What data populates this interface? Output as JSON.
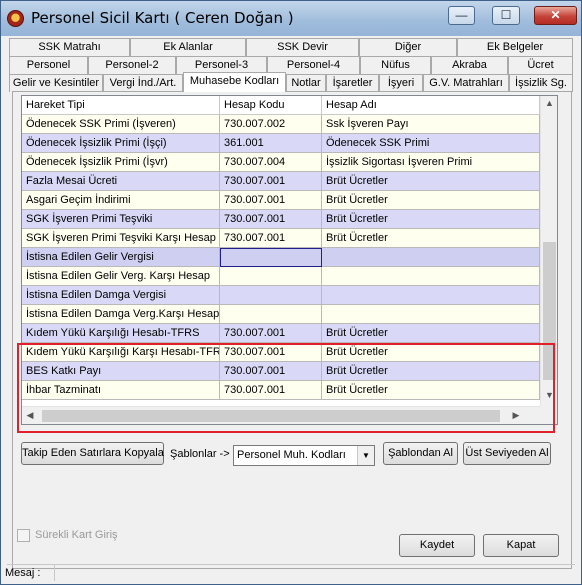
{
  "window": {
    "title": "Personel Sicil Kartı ( Ceren Doğan )",
    "controls": {
      "minimize": "—",
      "maximize": "☐",
      "close": "✕"
    }
  },
  "tabs": {
    "row1": [
      "SSK Matrahı",
      "Ek Alanlar",
      "SSK Devir",
      "Diğer",
      "Ek Belgeler"
    ],
    "row2": [
      "Personel",
      "Personel-2",
      "Personel-3",
      "Personel-4",
      "Nüfus",
      "Akraba",
      "Ücret"
    ],
    "row3": [
      "Gelir ve Kesintiler",
      "Vergi İnd./Art.",
      "Muhasebe Kodları",
      "Notlar",
      "İşaretler",
      "İşyeri",
      "G.V. Matrahları",
      "İşsizlik Sg."
    ],
    "active": "Muhasebe Kodları"
  },
  "grid": {
    "headers": [
      "Hareket Tipi",
      "Hesap Kodu",
      "Hesap Adı"
    ],
    "rows": [
      [
        "Ödenecek SSK Primi (İşveren)",
        "730.007.002",
        "Ssk İşveren Payı"
      ],
      [
        "Ödenecek İşsizlik Primi (İşçi)",
        "361.001",
        "Ödenecek SSK Primi"
      ],
      [
        "Ödenecek İşsizlik Primi (İşvr)",
        "730.007.004",
        "İşsizlik Sigortası İşveren Primi"
      ],
      [
        "Fazla Mesai Ücreti",
        "730.007.001",
        "Brüt Ücretler"
      ],
      [
        "Asgari Geçim İndirimi",
        "730.007.001",
        "Brüt Ücretler"
      ],
      [
        "SGK İşveren Primi Teşviki",
        "730.007.001",
        "Brüt Ücretler"
      ],
      [
        "SGK İşveren Primi Teşviki Karşı Hesap",
        "730.007.001",
        "Brüt Ücretler"
      ],
      [
        "İstisna Edilen Gelir Vergisi",
        "",
        ""
      ],
      [
        "İstisna Edilen Gelir Verg. Karşı Hesap",
        "",
        ""
      ],
      [
        "İstisna Edilen Damga Vergisi",
        "",
        ""
      ],
      [
        "İstisna Edilen Damga Verg.Karşı Hesap",
        "",
        ""
      ],
      [
        "Kıdem Yükü Karşılığı Hesabı-TFRS",
        "730.007.001",
        "Brüt Ücretler"
      ],
      [
        "Kıdem Yükü Karşılığı Karşı Hesabı-TFRS",
        "730.007.001",
        "Brüt Ücretler"
      ],
      [
        "BES Katkı Payı",
        "730.007.001",
        "Brüt Ücretler"
      ],
      [
        "İhbar Tazminatı",
        "730.007.001",
        "Brüt Ücretler"
      ]
    ]
  },
  "toolbar": {
    "copy_button": "Takip Eden Satırlara Kopyala",
    "templates_label": "Şablonlar ->",
    "templates_value": "Personel Muh. Kodları",
    "from_template_button": "Şablondan Al",
    "from_upper_button": "Üst Seviyeden Al"
  },
  "footer": {
    "checkbox_label": "Sürekli Kart Giriş",
    "save_button": "Kaydet",
    "close_button": "Kapat",
    "status_label": "Mesaj :"
  }
}
